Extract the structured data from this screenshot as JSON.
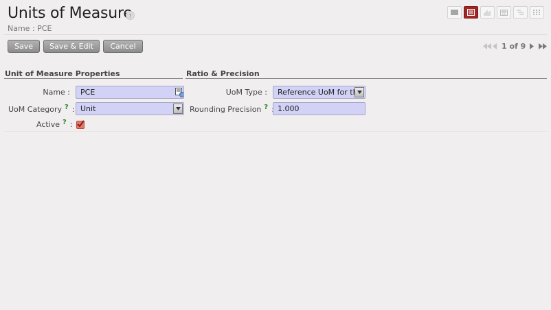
{
  "header": {
    "title": "Units of Measure",
    "help_glyph": "?",
    "subtitle": "Name : PCE"
  },
  "view_switcher": [
    {
      "name": "list-view-icon",
      "active": false
    },
    {
      "name": "form-view-icon",
      "active": true
    },
    {
      "name": "graph-view-icon",
      "active": false
    },
    {
      "name": "calendar-view-icon",
      "active": false
    },
    {
      "name": "gantt-view-icon",
      "active": false
    },
    {
      "name": "kanban-view-icon",
      "active": false
    }
  ],
  "toolbar": {
    "save_label": "Save",
    "save_edit_label": "Save & Edit",
    "cancel_label": "Cancel"
  },
  "pager": {
    "text": "1 of 9"
  },
  "form": {
    "left_section": "Unit of Measure Properties",
    "right_section": "Ratio & Precision",
    "help_mark": "?",
    "name_label": "Name :",
    "name_value": "PCE",
    "category_label": "UoM Category",
    "category_colon": ":",
    "category_value": "Unit",
    "active_label": "Active",
    "active_colon": ":",
    "active_checked": true,
    "uom_type_label": "UoM Type :",
    "uom_type_value": "Reference UoM for this",
    "rounding_label": "Rounding Precision",
    "rounding_colon": ":",
    "rounding_value": "1.000"
  },
  "colors": {
    "field_bg": "#d2d2f6",
    "active_view": "#a32424",
    "help_green": "#2d8a2d"
  }
}
